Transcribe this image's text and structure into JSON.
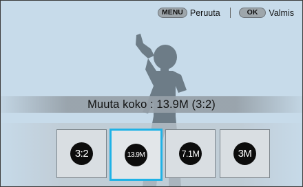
{
  "hints": {
    "menu_key": "MENU",
    "menu_action": "Peruuta",
    "ok_key": "OK",
    "ok_action": "Valmis"
  },
  "banner": {
    "text": "Muuta koko : 13.9M (3:2)"
  },
  "options": [
    {
      "label": "3:2",
      "selected": false
    },
    {
      "label": "13.9M",
      "selected": true
    },
    {
      "label": "7.1M",
      "selected": false
    },
    {
      "label": "3M",
      "selected": false
    }
  ],
  "colors": {
    "background": "#c7dbea",
    "selection_border": "#1fb2e6",
    "silhouette": "#5f6f7a"
  }
}
